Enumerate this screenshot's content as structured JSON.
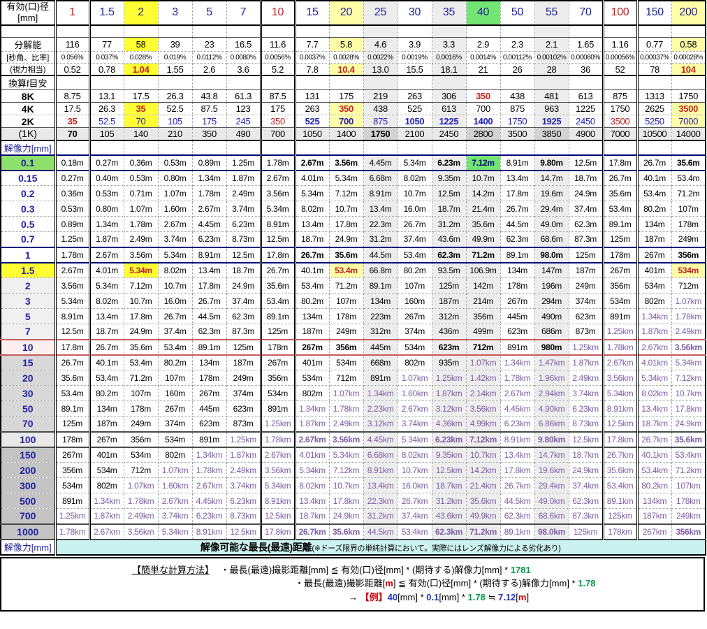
{
  "colors": {
    "accent_navy": "#1F1FA0",
    "accent_red": "#C42222",
    "km_violet": "#7A5FA5",
    "yellow_bright": "#FFFF33",
    "yellow_pale": "#FFFFA8",
    "green_cell": "#73E573",
    "cyan_band": "#CCF2F0",
    "formula_green": "#009B48"
  },
  "table": {
    "corner_title": "有効(口)径\n[mm]",
    "diameters": [
      "1",
      "1.5",
      "2",
      "3",
      "5",
      "7",
      "10",
      "15",
      "20",
      "25",
      "30",
      "35",
      "40",
      "50",
      "55",
      "70",
      "100",
      "150",
      "200"
    ],
    "resolution": {
      "label1": "分解能",
      "label2": "[秒角、比率]",
      "label3": "(視力相当)",
      "arcsec": [
        "116",
        "77",
        "58",
        "39",
        "23",
        "16.5",
        "11.6",
        "7.7",
        "5.8",
        "4.6",
        "3.9",
        "3.3",
        "2.9",
        "2.3",
        "2.1",
        "1.65",
        "1.16",
        "0.77",
        "0.58"
      ],
      "ratio": [
        "0.056%",
        "0.037%",
        "0.028%",
        "0.019%",
        "0.0112%",
        "0.0080%",
        "0.0056%",
        "0.0037%",
        "0.0028%",
        "0.0022%",
        "0.0019%",
        "0.0016%",
        "0.0014%",
        "0.00112%",
        "0.00102%",
        "0.00080%",
        "0.00056%",
        "0.00037%",
        "0.00028%"
      ],
      "vision": [
        "0.52",
        "0.78",
        "1.04",
        "1.55",
        "2.6",
        "3.6",
        "5.2",
        "7.8",
        "10.4",
        "13.0",
        "15.5",
        "18.1",
        "21",
        "26",
        "28",
        "36",
        "52",
        "78",
        "104"
      ]
    },
    "focal": {
      "label": "換算f目安",
      "rows": [
        {
          "label": "8K",
          "values": [
            "8.75",
            "13.1",
            "17.5",
            "26.3",
            "43.8",
            "61.3",
            "87.5",
            "131",
            "175",
            "219",
            "263",
            "306",
            "350",
            "438",
            "481",
            "613",
            "875",
            "1313",
            "1750"
          ]
        },
        {
          "label": "4K",
          "values": [
            "17.5",
            "26.3",
            "35",
            "52.5",
            "87.5",
            "123",
            "175",
            "263",
            "350",
            "438",
            "525",
            "613",
            "700",
            "875",
            "963",
            "1225",
            "1750",
            "2625",
            "3500"
          ]
        },
        {
          "label": "2K",
          "values": [
            "35",
            "52.5",
            "70",
            "105",
            "175",
            "245",
            "350",
            "525",
            "700",
            "875",
            "1050",
            "1225",
            "1400",
            "1750",
            "1925",
            "2450",
            "3500",
            "5250",
            "7000"
          ]
        },
        {
          "label": "(1K)",
          "values": [
            "70",
            "105",
            "140",
            "210",
            "350",
            "490",
            "700",
            "1050",
            "1400",
            "1750",
            "2100",
            "2450",
            "2800",
            "3500",
            "3850",
            "4900",
            "7000",
            "10500",
            "14000"
          ]
        }
      ]
    },
    "body": {
      "label": "解像力[mm]",
      "rows": [
        {
          "label": "0.1",
          "values": [
            "0.18m",
            "0.27m",
            "0.36m",
            "0.53m",
            "0.89m",
            "1.25m",
            "1.78m",
            "2.67m",
            "3.56m",
            "4.45m",
            "5.34m",
            "6.23m",
            "7.12m",
            "8.91m",
            "9.80m",
            "12.5m",
            "17.8m",
            "26.7m",
            "35.6m"
          ]
        },
        {
          "label": "0.15",
          "values": [
            "0.27m",
            "0.40m",
            "0.53m",
            "0.80m",
            "1.34m",
            "1.87m",
            "2.67m",
            "4.01m",
            "5.34m",
            "6.68m",
            "8.02m",
            "9.35m",
            "10.7m",
            "13.4m",
            "14.7m",
            "18.7m",
            "26.7m",
            "40.1m",
            "53.4m"
          ]
        },
        {
          "label": "0.2",
          "values": [
            "0.36m",
            "0.53m",
            "0.71m",
            "1.07m",
            "1.78m",
            "2.49m",
            "3.56m",
            "5.34m",
            "7.12m",
            "8.91m",
            "10.7m",
            "12.5m",
            "14.2m",
            "17.8m",
            "19.6m",
            "24.9m",
            "35.6m",
            "53.4m",
            "71.2m"
          ]
        },
        {
          "label": "0.3",
          "values": [
            "0.53m",
            "0.80m",
            "1.07m",
            "1.60m",
            "2.67m",
            "3.74m",
            "5.34m",
            "8.02m",
            "10.7m",
            "13.4m",
            "16.0m",
            "18.7m",
            "21.4m",
            "26.7m",
            "29.4m",
            "37.4m",
            "53.4m",
            "80.2m",
            "107m"
          ]
        },
        {
          "label": "0.5",
          "values": [
            "0.89m",
            "1.34m",
            "1.78m",
            "2.67m",
            "4.45m",
            "6.23m",
            "8.91m",
            "13.4m",
            "17.8m",
            "22.3m",
            "26.7m",
            "31.2m",
            "35.6m",
            "44.5m",
            "49.0m",
            "62.3m",
            "89.1m",
            "134m",
            "178m"
          ]
        },
        {
          "label": "0.7",
          "values": [
            "1.25m",
            "1.87m",
            "2.49m",
            "3.74m",
            "6.23m",
            "8.73m",
            "12.5m",
            "18.7m",
            "24.9m",
            "31.2m",
            "37.4m",
            "43.6m",
            "49.9m",
            "62.3m",
            "68.6m",
            "87.3m",
            "125m",
            "187m",
            "249m"
          ]
        },
        {
          "label": "1",
          "values": [
            "1.78m",
            "2.67m",
            "3.56m",
            "5.34m",
            "8.91m",
            "12.5m",
            "17.8m",
            "26.7m",
            "35.6m",
            "44.5m",
            "53.4m",
            "62.3m",
            "71.2m",
            "89.1m",
            "98.0m",
            "125m",
            "178m",
            "267m",
            "356m"
          ]
        },
        {
          "label": "1.5",
          "values": [
            "2.67m",
            "4.01m",
            "5.34m",
            "8.02m",
            "13.4m",
            "18.7m",
            "26.7m",
            "40.1m",
            "53.4m",
            "66.8m",
            "80.2m",
            "93.5m",
            "106.9m",
            "134m",
            "147m",
            "187m",
            "267m",
            "401m",
            "534m"
          ]
        },
        {
          "label": "2",
          "values": [
            "3.56m",
            "5.34m",
            "7.12m",
            "10.7m",
            "17.8m",
            "24.9m",
            "35.6m",
            "53.4m",
            "71.2m",
            "89.1m",
            "107m",
            "125m",
            "142m",
            "178m",
            "196m",
            "249m",
            "356m",
            "534m",
            "712m"
          ]
        },
        {
          "label": "3",
          "values": [
            "5.34m",
            "8.02m",
            "10.7m",
            "16.0m",
            "26.7m",
            "37.4m",
            "53.4m",
            "80.2m",
            "107m",
            "134m",
            "160m",
            "187m",
            "214m",
            "267m",
            "294m",
            "374m",
            "534m",
            "802m",
            "1.07km"
          ]
        },
        {
          "label": "5",
          "values": [
            "8.91m",
            "13.4m",
            "17.8m",
            "26.7m",
            "44.5m",
            "62.3m",
            "89.1m",
            "134m",
            "178m",
            "223m",
            "267m",
            "312m",
            "356m",
            "445m",
            "490m",
            "623m",
            "891m",
            "1.34km",
            "1.78km"
          ]
        },
        {
          "label": "7",
          "values": [
            "12.5m",
            "18.7m",
            "24.9m",
            "37.4m",
            "62.3m",
            "87.3m",
            "125m",
            "187m",
            "249m",
            "312m",
            "374m",
            "436m",
            "499m",
            "623m",
            "686m",
            "873m",
            "1.25km",
            "1.87km",
            "2.49km"
          ]
        },
        {
          "label": "10",
          "values": [
            "17.8m",
            "26.7m",
            "35.6m",
            "53.4m",
            "89.1m",
            "125m",
            "178m",
            "267m",
            "356m",
            "445m",
            "534m",
            "623m",
            "712m",
            "891m",
            "980m",
            "1.25km",
            "1.78km",
            "2.67km",
            "3.56km"
          ]
        },
        {
          "label": "15",
          "values": [
            "26.7m",
            "40.1m",
            "53.4m",
            "80.2m",
            "134m",
            "187m",
            "267m",
            "401m",
            "534m",
            "668m",
            "802m",
            "935m",
            "1.07km",
            "1.34km",
            "1.47km",
            "1.87km",
            "2.67km",
            "4.01km",
            "5.34km"
          ]
        },
        {
          "label": "20",
          "values": [
            "35.6m",
            "53.4m",
            "71.2m",
            "107m",
            "178m",
            "249m",
            "356m",
            "534m",
            "712m",
            "891m",
            "1.07km",
            "1.25km",
            "1.42km",
            "1.78km",
            "1.96km",
            "2.49km",
            "3.56km",
            "5.34km",
            "7.12km"
          ]
        },
        {
          "label": "30",
          "values": [
            "53.4m",
            "80.2m",
            "107m",
            "160m",
            "267m",
            "374m",
            "534m",
            "802m",
            "1.07km",
            "1.34km",
            "1.60km",
            "1.87km",
            "2.14km",
            "2.67km",
            "2.94km",
            "3.74km",
            "5.34km",
            "8.02km",
            "10.7km"
          ]
        },
        {
          "label": "50",
          "values": [
            "89.1m",
            "134m",
            "178m",
            "267m",
            "445m",
            "623m",
            "891m",
            "1.34km",
            "1.78km",
            "2.23km",
            "2.67km",
            "3.12km",
            "3.56km",
            "4.45km",
            "4.90km",
            "6.23km",
            "8.91km",
            "13.4km",
            "17.8km"
          ]
        },
        {
          "label": "70",
          "values": [
            "125m",
            "187m",
            "249m",
            "374m",
            "623m",
            "873m",
            "1.25km",
            "1.87km",
            "2.49km",
            "3.12km",
            "3.74km",
            "4.36km",
            "4.99km",
            "6.23km",
            "6.86km",
            "8.73km",
            "12.5km",
            "18.7km",
            "24.9km"
          ]
        },
        {
          "label": "100",
          "values": [
            "178m",
            "267m",
            "356m",
            "534m",
            "891m",
            "1.25km",
            "1.78km",
            "2.67km",
            "3.56km",
            "4.45km",
            "5.34km",
            "6.23km",
            "7.12km",
            "8.91km",
            "9.80km",
            "12.5km",
            "17.8km",
            "26.7km",
            "35.6km"
          ]
        },
        {
          "label": "150",
          "values": [
            "267m",
            "401m",
            "534m",
            "802m",
            "1.34km",
            "1.87km",
            "2.67km",
            "4.01km",
            "5.34km",
            "6.68km",
            "8.02km",
            "9.35km",
            "10.7km",
            "13.4km",
            "14.7km",
            "18.7km",
            "26.7km",
            "40.1km",
            "53.4km"
          ]
        },
        {
          "label": "200",
          "values": [
            "356m",
            "534m",
            "712m",
            "1.07km",
            "1.78km",
            "2.49km",
            "3.56km",
            "5.34km",
            "7.12km",
            "8.91km",
            "10.7km",
            "12.5km",
            "14.2km",
            "17.8km",
            "19.6km",
            "24.9km",
            "35.6km",
            "53.4km",
            "71.2km"
          ]
        },
        {
          "label": "300",
          "values": [
            "534m",
            "802m",
            "1.07km",
            "1.60km",
            "2.67km",
            "3.74km",
            "5.34km",
            "8.02km",
            "10.7km",
            "13.4km",
            "16.0km",
            "18.7km",
            "21.4km",
            "26.7km",
            "29.4km",
            "37.4km",
            "53.4km",
            "80.2km",
            "107km"
          ]
        },
        {
          "label": "500",
          "values": [
            "891m",
            "1.34km",
            "1.78km",
            "2.67km",
            "4.45km",
            "6.23km",
            "8.91km",
            "13.4km",
            "17.8km",
            "22.3km",
            "26.7km",
            "31.2km",
            "35.6km",
            "44.5km",
            "49.0km",
            "62.3km",
            "89.1km",
            "134km",
            "178km"
          ]
        },
        {
          "label": "700",
          "values": [
            "1.25km",
            "1.87km",
            "2.49km",
            "3.74km",
            "6.23km",
            "8.73km",
            "12.5km",
            "18.7km",
            "24.9km",
            "31.2km",
            "37.4km",
            "43.6km",
            "49.9km",
            "62.3km",
            "68.6km",
            "87.3km",
            "125km",
            "187km",
            "249km"
          ]
        },
        {
          "label": "1000",
          "values": [
            "1.78km",
            "2.67km",
            "3.56km",
            "5.34km",
            "8.91km",
            "12.5km",
            "17.8km",
            "26.7km",
            "35.6km",
            "44.5km",
            "53.4km",
            "62.3km",
            "71.2km",
            "89.1km",
            "98.0km",
            "125km",
            "178km",
            "267km",
            "356km"
          ]
        }
      ]
    },
    "footer": {
      "label": "解像力[mm]",
      "band_bold": "解像可能な最長(最遠)距離",
      "band_note": "(※ドーズ限界の単純計算において。実際にはレンズ解像力による劣化あり)"
    }
  },
  "notes": {
    "title": "【簡単な計算方法】",
    "line1_pre": "・最長(最遠)撮影距離[mm] ≦ 有効(口)径[mm] * (期待する)解像力[mm] * ",
    "line1_const": "1781",
    "line2_pre1": "・最長(最遠)撮影距離[",
    "line2_m": "m",
    "line2_pre2": "] ≦ 有効(口)径[mm] * (期待する)解像力[mm] * ",
    "line2_const": "1.78",
    "line3_arrow": "→ ",
    "line3_example": "【例】",
    "line3_d": "40",
    "line3_seg1": "[mm] * ",
    "line3_r": "0.1",
    "line3_seg2": "[mm] * ",
    "line3_const": "1.78",
    "line3_approx": " ≒ ",
    "line3_v": "7.12",
    "line3_open": "[",
    "line3_m": "m",
    "line3_close": "]"
  }
}
